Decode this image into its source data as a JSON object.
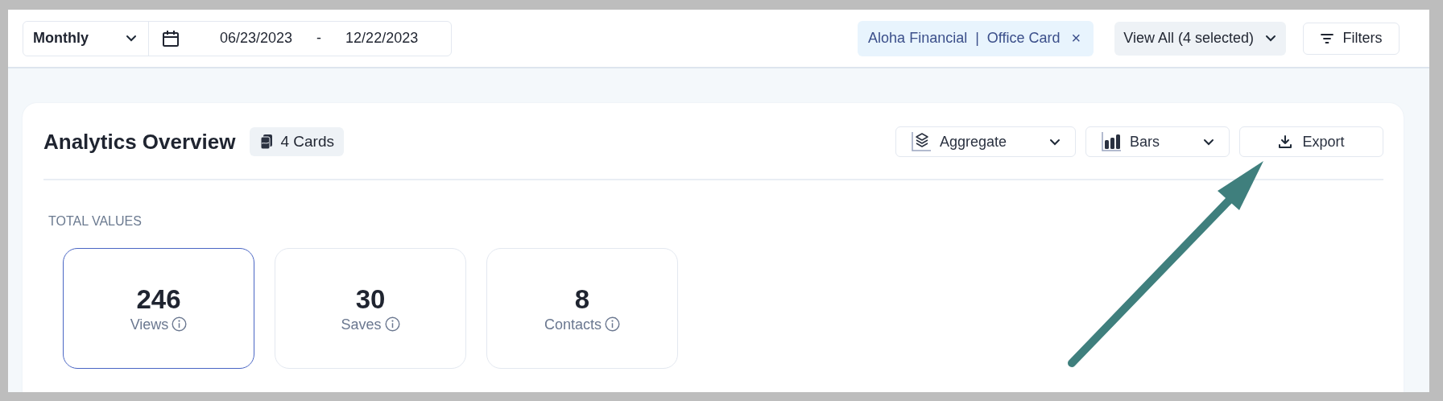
{
  "toolbar": {
    "period": {
      "value": "Monthly"
    },
    "date_range": {
      "start": "06/23/2023",
      "separator": "-",
      "end": "12/22/2023"
    },
    "filter_chip": {
      "account": "Aloha Financial",
      "divider": "|",
      "card": "Office Card",
      "remove": "×"
    },
    "view_select": {
      "value": "View All (4 selected)"
    },
    "filters_button": {
      "label": "Filters"
    }
  },
  "overview": {
    "title": "Analytics Overview",
    "badge": "4 Cards",
    "controls": [
      {
        "kind": "dropdown",
        "label": "Aggregate"
      },
      {
        "kind": "dropdown",
        "label": "Bars"
      },
      {
        "kind": "button",
        "label": "Export"
      }
    ],
    "section_label": "TOTAL VALUES",
    "stats": [
      {
        "value": "246",
        "label": "Views",
        "selected": true
      },
      {
        "value": "30",
        "label": "Saves",
        "selected": false
      },
      {
        "value": "8",
        "label": "Contacts",
        "selected": false
      }
    ]
  }
}
